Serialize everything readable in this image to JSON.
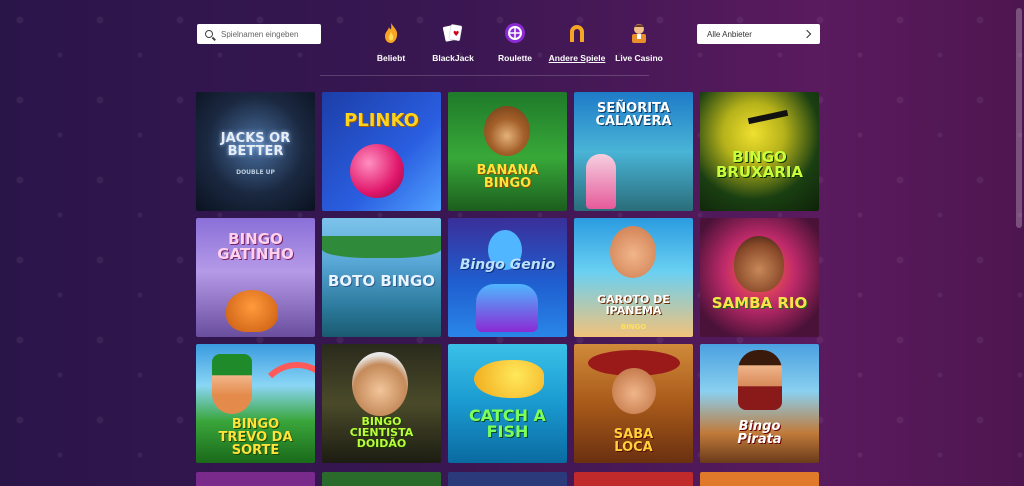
{
  "search": {
    "placeholder": "Spielnamen eingeben"
  },
  "provider": {
    "label": "Alle Anbieter"
  },
  "categories": [
    {
      "label": "Beliebt",
      "icon": "flame-icon"
    },
    {
      "label": "BlackJack",
      "icon": "cards-icon"
    },
    {
      "label": "Roulette",
      "icon": "roulette-icon"
    },
    {
      "label": "Andere Spiele",
      "icon": "horseshoe-icon",
      "active": true
    },
    {
      "label": "Live Casino",
      "icon": "dealer-icon"
    }
  ],
  "games": [
    {
      "title": "JACKS OR BETTER",
      "subtitle": "DOUBLE UP"
    },
    {
      "title": "PLINKO"
    },
    {
      "title": "BANANA BINGO"
    },
    {
      "title": "SEÑORITA CALAVERA"
    },
    {
      "title": "BINGO BRUXARIA"
    },
    {
      "title": "BINGO GATINHO"
    },
    {
      "title": "BOTO BINGO"
    },
    {
      "title": "Bingo Genio"
    },
    {
      "title": "GAROTO DE IPANEMA",
      "subtitle": "BINGO"
    },
    {
      "title": "SAMBA RIO"
    },
    {
      "title": "BINGO TREVO DA SORTE"
    },
    {
      "title": "BINGO CIENTISTA DOIDÃO"
    },
    {
      "title": "CATCH A FISH"
    },
    {
      "title": "SABA LOCA"
    },
    {
      "title": "Bingo Pirata"
    }
  ],
  "colors": {
    "accent": "#f5a623",
    "active_underline": "#ffffff"
  }
}
